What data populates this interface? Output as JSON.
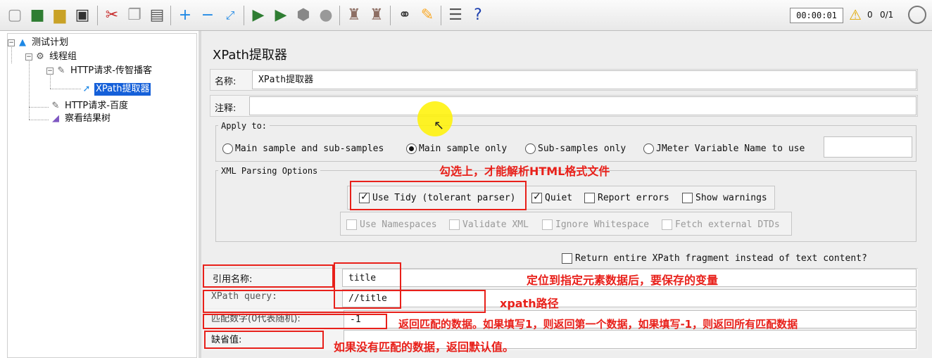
{
  "toolbar": {
    "icons": [
      "new-icon",
      "templates-icon",
      "open-icon",
      "save-icon",
      "cut-icon",
      "copy-icon",
      "paste-icon",
      "expand-icon",
      "collapse-icon",
      "toggle-icon",
      "start-icon",
      "start-no-pauses-icon",
      "stop-icon",
      "shutdown-icon",
      "clear-icon",
      "clear-all-icon",
      "search-icon",
      "reset-search-icon",
      "function-helper-icon",
      "help-icon"
    ],
    "timer": "00:00:01",
    "warning_count": "0",
    "threads": "0/1"
  },
  "tree": {
    "test_plan": "测试计划",
    "thread_group": "线程组",
    "http_request_1": "HTTP请求-传智播客",
    "xpath_extractor": "XPath提取器",
    "http_request_2": "HTTP请求-百度",
    "view_results_tree": "察看结果树"
  },
  "panel": {
    "title": "XPath提取器",
    "name_label": "名称:",
    "name_value": "XPath提取器",
    "comments_label": "注释:",
    "comments_value": "",
    "apply_to": {
      "legend": "Apply to:",
      "options": [
        "Main sample and sub-samples",
        "Main sample only",
        "Sub-samples only",
        "JMeter Variable Name to use"
      ],
      "selected": "Main sample only",
      "variable_value": ""
    },
    "xml_parsing": {
      "legend": "XML Parsing Options",
      "use_tidy": "Use Tidy (tolerant parser)",
      "quiet": "Quiet",
      "report_errors": "Report errors",
      "show_warnings": "Show warnings",
      "use_namespaces": "Use Namespaces",
      "validate_xml": "Validate XML",
      "ignore_whitespace": "Ignore Whitespace",
      "fetch_dtds": "Fetch external DTDs"
    },
    "return_fragment": "Return entire XPath fragment instead of text content?",
    "reference_name_label": "引用名称:",
    "reference_name_value": "title",
    "xpath_query_label": "XPath query:",
    "xpath_query_value": "//title",
    "match_no_label": "匹配数字(0代表随机):",
    "match_no_value": "-1",
    "default_label": "缺省值:",
    "default_value": ""
  },
  "annotations": {
    "tidy_note": "勾选上，才能解析HTML格式文件",
    "ref_note": "定位到指定元素数据后，要保存的变量",
    "xpath_note": "xpath路径",
    "match_note": "返回匹配的数据。如果填写1，则返回第一个数据，如果填写-1，则返回所有匹配数据",
    "default_note": "如果没有匹配的数据，返回默认值。"
  },
  "colors": {
    "annotation_red": "#e8201a",
    "selection_blue": "#1560d9",
    "cursor_highlight": "#fff200"
  }
}
